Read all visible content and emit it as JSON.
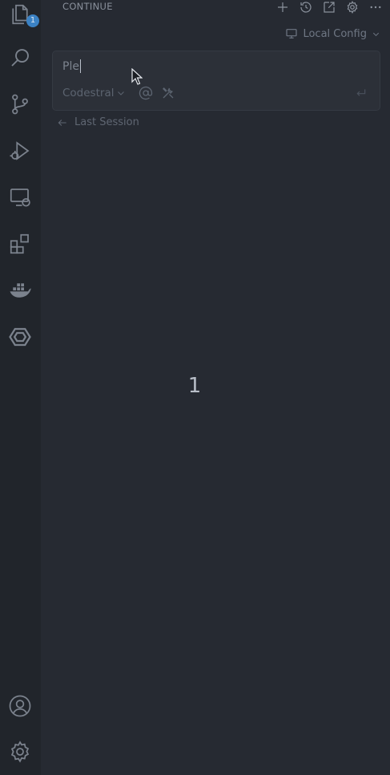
{
  "activity_bar": {
    "explorer_badge": "1",
    "icons": [
      "files-icon",
      "search-icon",
      "source-control-icon",
      "run-debug-icon",
      "remote-explorer-icon",
      "extensions-icon",
      "docker-icon",
      "continue-icon",
      "account-icon",
      "manage-gear-icon"
    ]
  },
  "panel": {
    "title": "CONTINUE",
    "config_label": "Local Config",
    "input": {
      "value": "Ple"
    },
    "model": "Codestral",
    "last_session_label": "Last Session",
    "center_number": "1"
  },
  "colors": {
    "background": "#262a32",
    "activity_bar": "#21252b",
    "icon": "#8b929d",
    "badge": "#3b82c4"
  }
}
